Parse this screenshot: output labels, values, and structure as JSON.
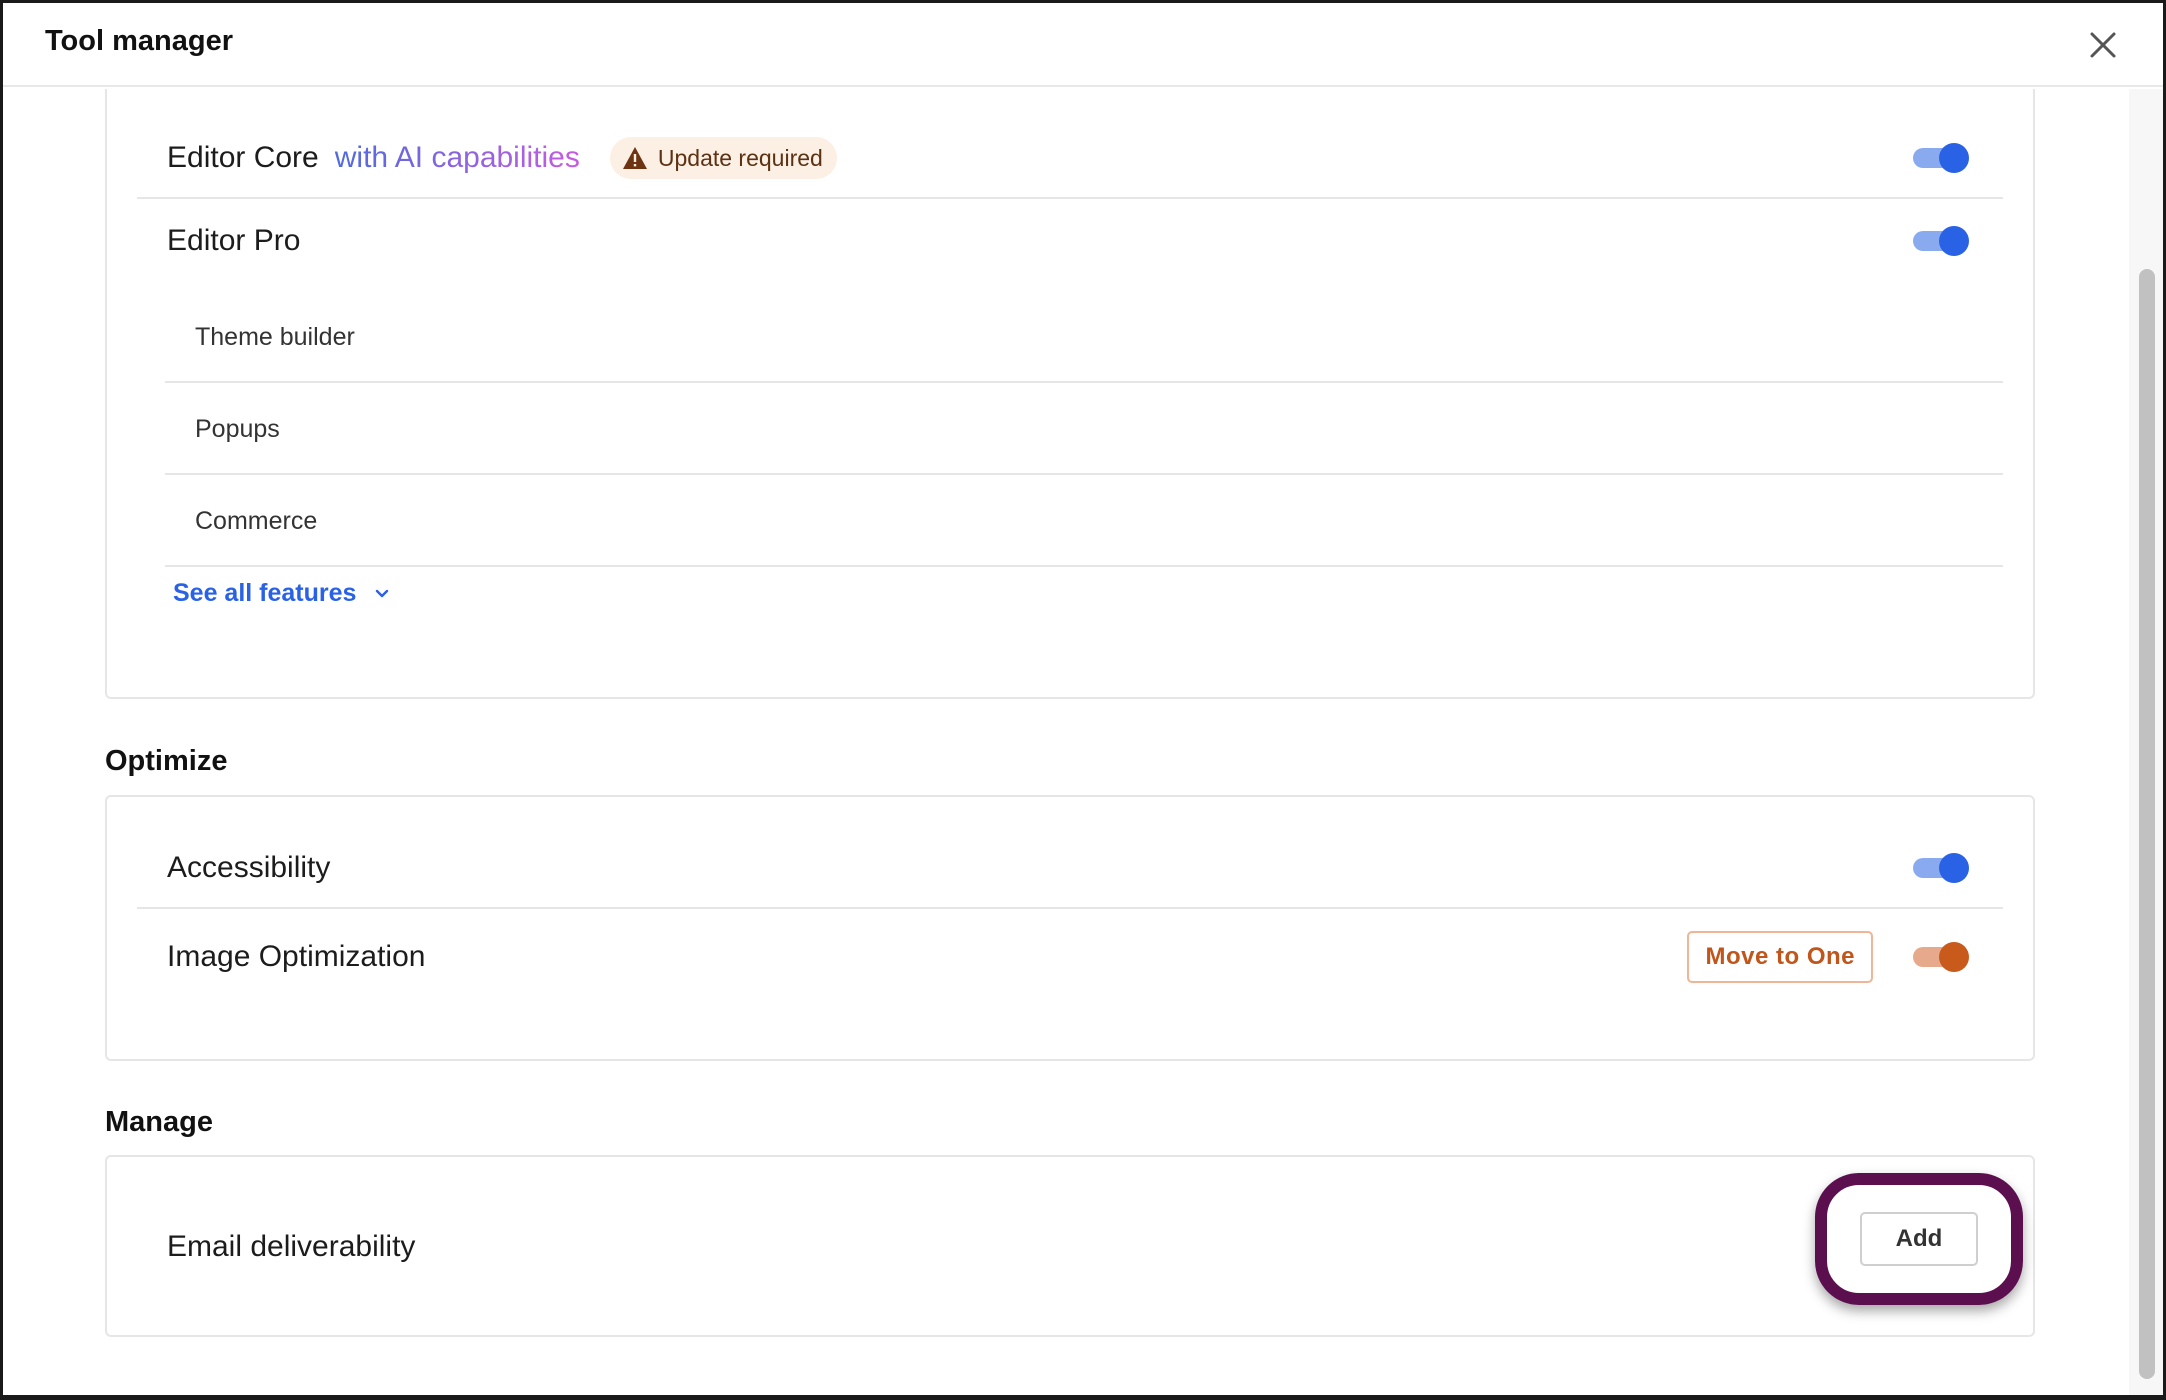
{
  "window": {
    "title": "Tool manager"
  },
  "editor_section": {
    "editor_core": {
      "label": "Editor Core",
      "ai_label": "with AI capabilities",
      "badge": "Update required",
      "toggle_on": true
    },
    "editor_pro": {
      "label": "Editor Pro",
      "toggle_on": true,
      "features": [
        "Theme builder",
        "Popups",
        "Commerce"
      ],
      "see_all": "See all features"
    }
  },
  "optimize_section": {
    "title": "Optimize",
    "items": [
      {
        "label": "Accessibility",
        "toggle_on": true,
        "toggle_color": "#2a62e6"
      },
      {
        "label": "Image Optimization",
        "action": "Move to One",
        "toggle_on": true,
        "toggle_color": "#c85a1c"
      }
    ]
  },
  "manage_section": {
    "title": "Manage",
    "items": [
      {
        "label": "Email deliverability",
        "action": "Add"
      }
    ]
  },
  "icons": {
    "close": "close-icon",
    "warning": "warning-icon",
    "chevron": "chevron-down-icon"
  },
  "colors": {
    "accent_blue": "#2a62e6",
    "accent_orange": "#c85a1c",
    "highlight": "#5b0f4e"
  }
}
